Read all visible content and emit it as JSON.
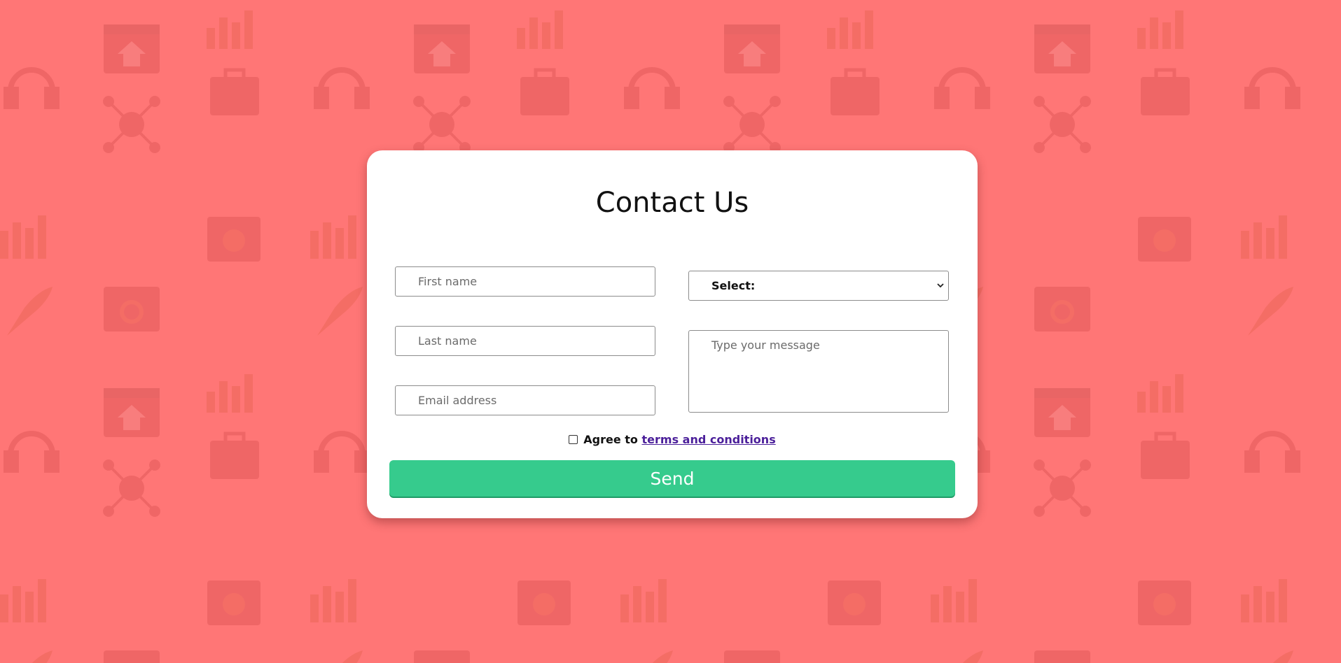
{
  "page": {
    "background_color": "#ff7676",
    "pattern_icons": [
      "headset-icon",
      "browser-home-icon",
      "bar-chart-icon",
      "toolbox-icon",
      "network-icon",
      "rocket-icon",
      "gear-icon",
      "magnifier-icon",
      "lifebuoy-icon",
      "calendar-icon",
      "lightbulb-icon",
      "magnet-icon",
      "cart-icon",
      "key-icon"
    ]
  },
  "form": {
    "title": "Contact Us",
    "first_name_placeholder": "First name",
    "last_name_placeholder": "Last name",
    "email_placeholder": "Email address",
    "select_value": "Select:",
    "message_placeholder": "Type your message",
    "agree_text": "Agree to",
    "terms_link": "terms and conditions",
    "send_label": "Send",
    "send_color": "#36cb8d",
    "link_color": "#4b1f9a"
  }
}
